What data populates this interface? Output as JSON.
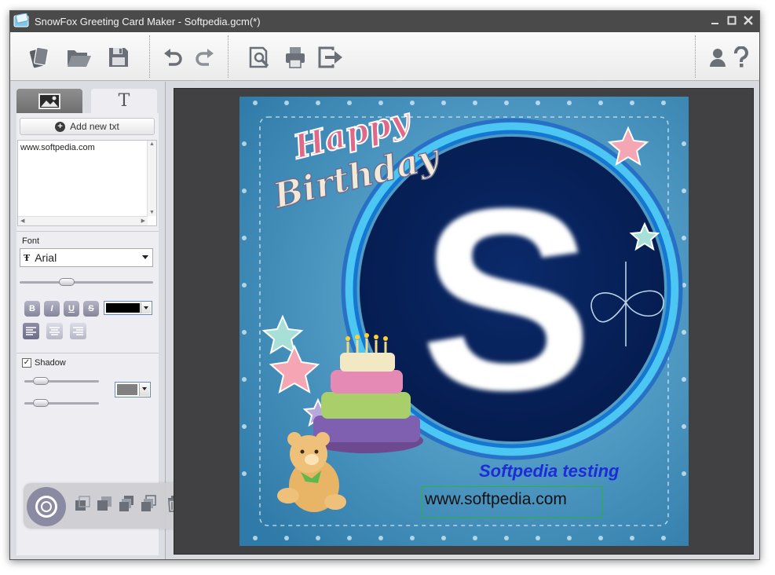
{
  "window": {
    "title": "SnowFox Greeting Card Maker - Softpedia.gcm(*)"
  },
  "toolbar": {
    "buttons": [
      "new-card-icon",
      "open-folder-icon",
      "save-icon",
      "undo-icon",
      "redo-icon",
      "print-preview-icon",
      "print-icon",
      "export-icon",
      "account-icon",
      "help-icon"
    ]
  },
  "sidebar": {
    "tabs": {
      "image_icon": "picture-icon",
      "text_label": "T"
    },
    "add_button_label": "Add new txt",
    "text_value": "www.softpedia.com",
    "font": {
      "label": "Font",
      "selected": "Arial",
      "size_slider_fraction": 0.33,
      "text_color": "#000000",
      "style_buttons": [
        "B",
        "I",
        "U",
        "S"
      ]
    },
    "shadow": {
      "label": "Shadow",
      "checked": true,
      "slider1_fraction": 0.15,
      "slider2_fraction": 0.15,
      "color": "#808080"
    }
  },
  "card": {
    "logo_letter": "S",
    "happy_text": "Happy",
    "birthday_text": "Birthday",
    "texts": [
      {
        "text": "Softpedia testing",
        "color": "#1e2cd8"
      },
      {
        "text": "www.softpedia.com",
        "color": "#111111"
      }
    ],
    "background_color": "#3e8fbc"
  }
}
